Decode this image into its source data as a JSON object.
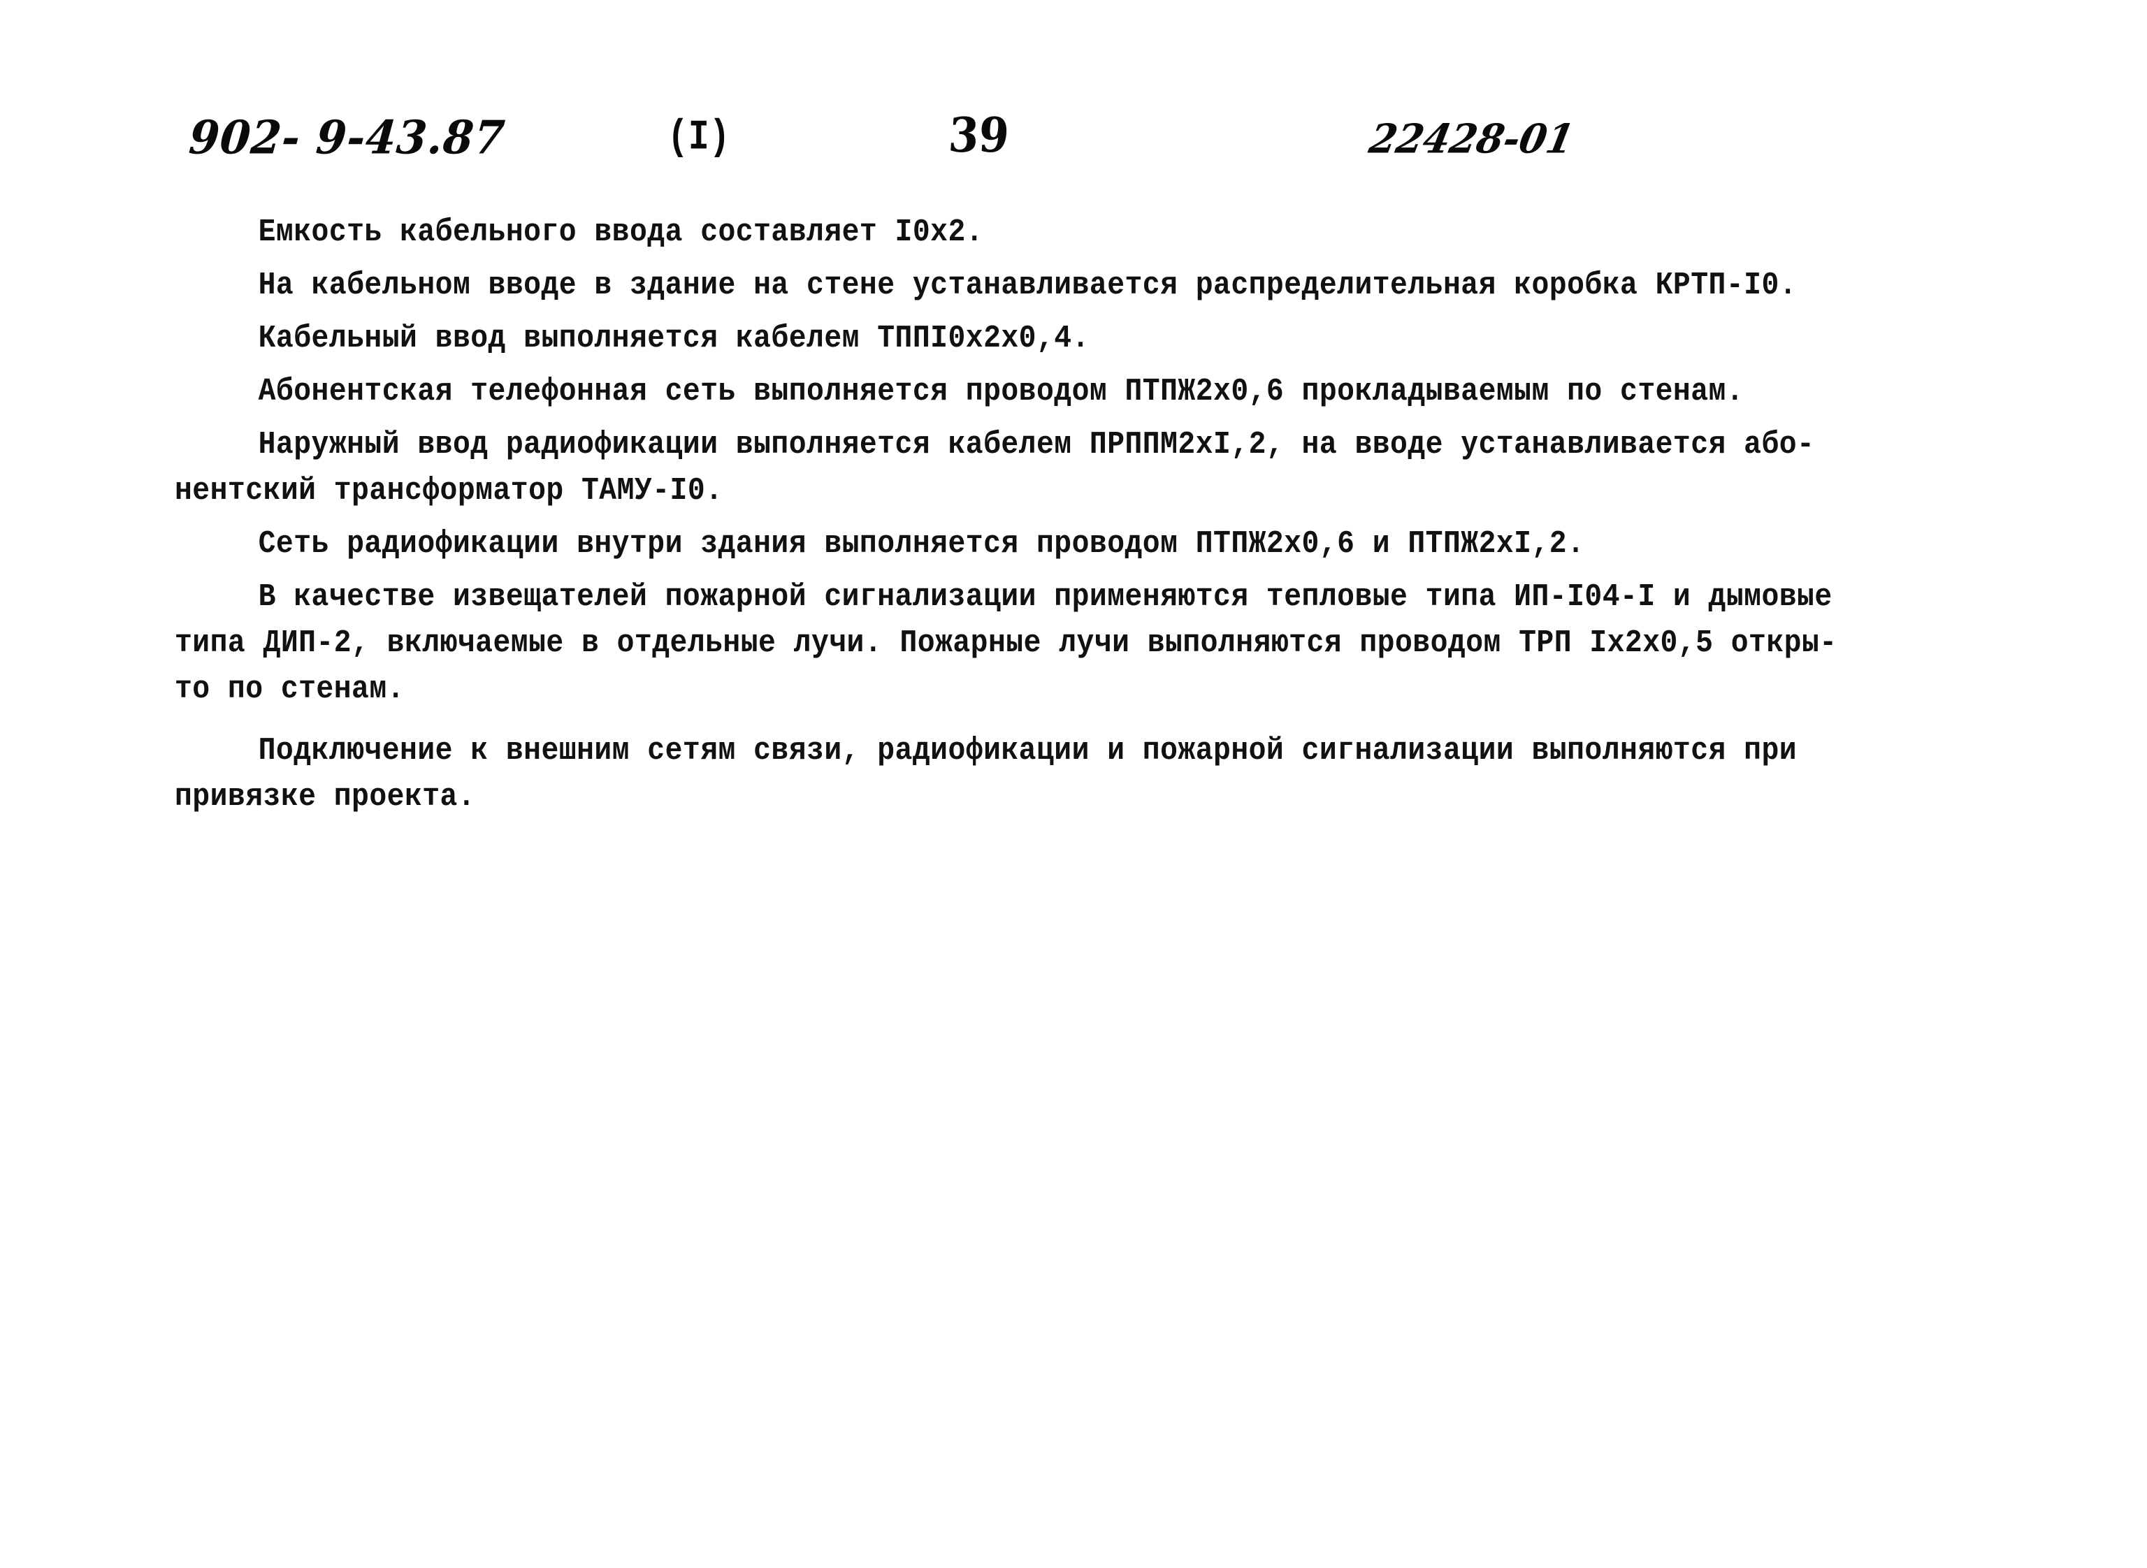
{
  "document": {
    "kind": "scanned-typewritten-page",
    "language": "ru",
    "page_background": "#ffffff",
    "ink_color": "#111111"
  },
  "header": {
    "album_code": "902- 9-43.87",
    "part_marker": "(I)",
    "page_number": "39",
    "drawing_number": "22428-01"
  },
  "body": {
    "paragraphs": [
      {
        "id": "cable-entry-capacity",
        "lines": [
          {
            "text": "Емкость кабельного ввода составляет I0x2.",
            "indent": true
          }
        ]
      },
      {
        "id": "distribution-box",
        "lines": [
          {
            "text": "На кабельном вводе в здание на стене устанавливается распределительная коробка КРТП-I0.",
            "indent": true
          }
        ]
      },
      {
        "id": "cable-entry-type",
        "lines": [
          {
            "text": "Кабельный ввод выполняется кабелем ТППI0x2x0,4.",
            "indent": true
          }
        ]
      },
      {
        "id": "subscriber-telephone-network",
        "lines": [
          {
            "text": "Абонентская телефонная сеть выполняется проводом ПТПЖ2х0,6 прокладываемым по стенам.",
            "indent": true
          }
        ]
      },
      {
        "id": "external-radio-entry",
        "lines": [
          {
            "text": "Наружный ввод радиофикации выполняется кабелем ПРППМ2хI,2, на вводе устанавливается або-",
            "indent": true
          },
          {
            "text": "нентский трансформатор ТАМУ-I0.",
            "indent": false
          }
        ]
      },
      {
        "id": "internal-radio-network",
        "lines": [
          {
            "text": "Сеть радиофикации внутри здания выполняется проводом ПТПЖ2х0,6 и ПТПЖ2хI,2.",
            "indent": true
          }
        ]
      },
      {
        "id": "fire-alarm-detectors",
        "lines": [
          {
            "text": "В качестве извещателей пожарной сигнализации применяются тепловые типа ИП-I04-I и дымовые",
            "indent": true
          },
          {
            "text": "типа ДИП-2, включаемые в отдельные лучи. Пожарные лучи выполняются проводом ТРП Iх2х0,5 откры-",
            "indent": false
          },
          {
            "text": "то по стенам.",
            "indent": false
          }
        ]
      },
      {
        "id": "external-connections",
        "lines": [
          {
            "text": "Подключение к внешним сетям связи, радиофикации и пожарной сигнализации выполняются при",
            "indent": true
          },
          {
            "text": "привязке проекта.",
            "indent": false
          }
        ]
      }
    ]
  }
}
